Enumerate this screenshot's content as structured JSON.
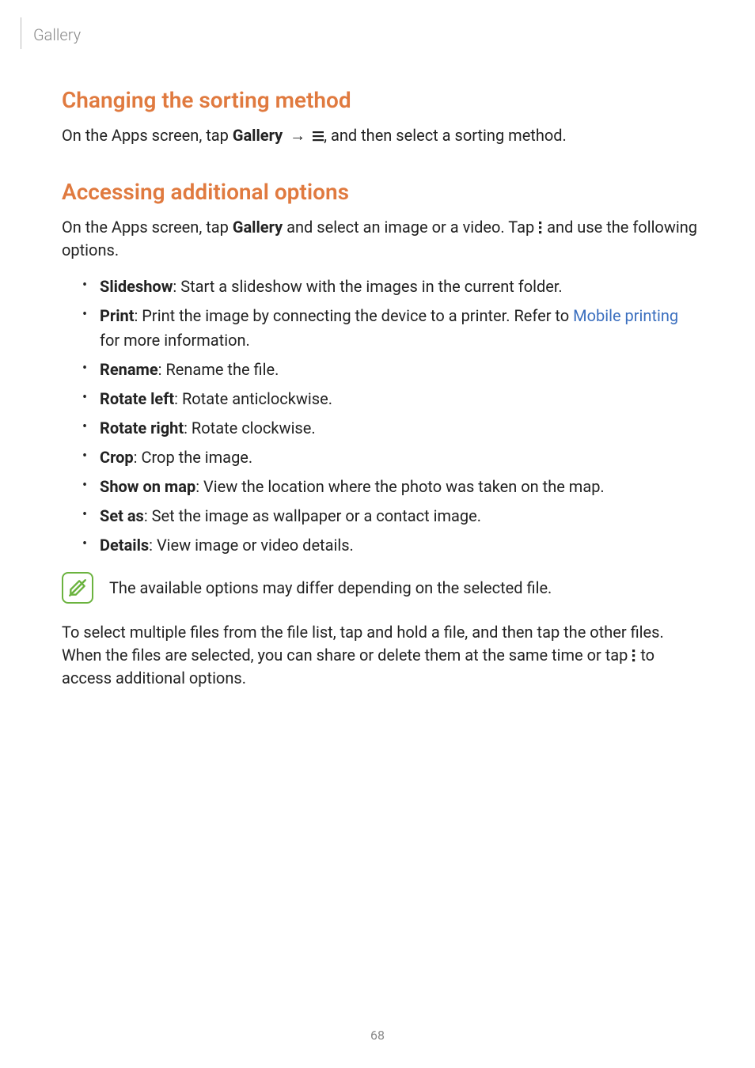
{
  "breadcrumb": "Gallery",
  "section1": {
    "title": "Changing the sorting method",
    "intro_pre": "On the Apps screen, tap ",
    "intro_bold": "Gallery",
    "intro_post": ", and then select a sorting method."
  },
  "section2": {
    "title": "Accessing additional options",
    "intro_pre": "On the Apps screen, tap ",
    "intro_bold": "Gallery",
    "intro_mid": " and select an image or a video. Tap ",
    "intro_post": " and use the following options.",
    "items": [
      {
        "term": "Slideshow",
        "desc": ": Start a slideshow with the images in the current folder."
      },
      {
        "term": "Print",
        "desc_pre": ": Print the image by connecting the device to a printer. Refer to ",
        "link": "Mobile printing",
        "desc_post": " for more information."
      },
      {
        "term": "Rename",
        "desc": ": Rename the file."
      },
      {
        "term": "Rotate left",
        "desc": ": Rotate anticlockwise."
      },
      {
        "term": "Rotate right",
        "desc": ": Rotate clockwise."
      },
      {
        "term": "Crop",
        "desc": ": Crop the image."
      },
      {
        "term": "Show on map",
        "desc": ": View the location where the photo was taken on the map."
      },
      {
        "term": "Set as",
        "desc": ": Set the image as wallpaper or a contact image."
      },
      {
        "term": "Details",
        "desc": ": View image or video details."
      }
    ],
    "note": "The available options may differ depending on the selected file.",
    "closing_pre": "To select multiple files from the file list, tap and hold a file, and then tap the other files. When the files are selected, you can share or delete them at the same time or tap ",
    "closing_post": " to access additional options."
  },
  "icons": {
    "menu": "menu-icon",
    "more": "more-vert-icon",
    "note": "note-icon"
  },
  "page_number": "68"
}
